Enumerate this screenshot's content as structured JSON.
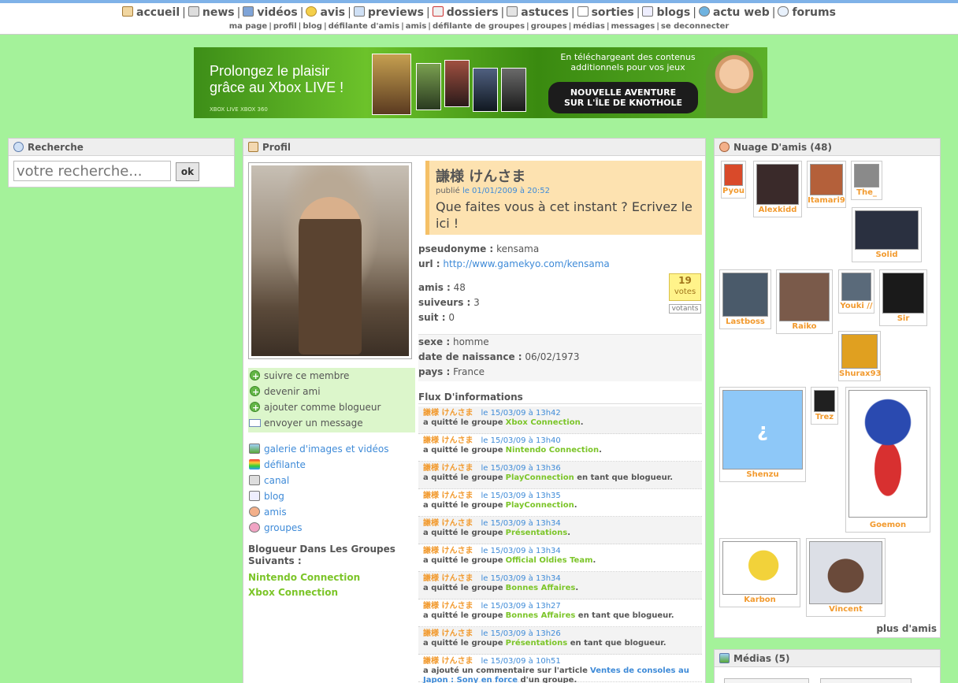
{
  "nav": {
    "main": [
      {
        "label": "accueil",
        "icon": "home-icon"
      },
      {
        "label": "news",
        "icon": "news-icon"
      },
      {
        "label": "vidéos",
        "icon": "video-icon"
      },
      {
        "label": "avis",
        "icon": "medal-icon"
      },
      {
        "label": "previews",
        "icon": "document-icon"
      },
      {
        "label": "dossiers",
        "icon": "folder-icon"
      },
      {
        "label": "astuces",
        "icon": "gamepad-icon"
      },
      {
        "label": "sorties",
        "icon": "calendar-icon"
      },
      {
        "label": "blogs",
        "icon": "blog-icon"
      },
      {
        "label": "actu web",
        "icon": "globe-icon"
      },
      {
        "label": "forums",
        "icon": "speech-bubble-icon"
      }
    ],
    "sub": [
      "ma page",
      "profil",
      "blog",
      "défilante d'amis",
      "amis",
      "défilante de groupes",
      "groupes",
      "médias",
      "messages",
      "se deconnecter"
    ]
  },
  "banner": {
    "headline_1": "Prolongez le plaisir",
    "headline_2": "grâce au Xbox LIVE !",
    "brand": "XBOX LIVE  XBOX 360",
    "side_1": "En téléchargeant des contenus",
    "side_2": "additionnels pour vos jeux",
    "cta_1": "NOUVELLE AVENTURE",
    "cta_2": "SUR L'ÎLE DE KNOTHOLE"
  },
  "search": {
    "title": "Recherche",
    "placeholder": "votre recherche...",
    "button": "ok"
  },
  "profile": {
    "title": "Profil",
    "name": "謙様 けんさま",
    "published_prefix": "publié",
    "published_date": "le 01/01/2009 à 20:52",
    "status": "Que faites vous à cet instant ? Ecrivez le ici !",
    "pseudonyme_label": "pseudonyme :",
    "pseudonyme": "kensama",
    "url_label": "url :",
    "url": "http://www.gamekyo.com/kensama",
    "amis_label": "amis :",
    "amis": "48",
    "suiveurs_label": "suiveurs :",
    "suiveurs": "3",
    "suit_label": "suit :",
    "suit": "0",
    "votes_count": "19",
    "votes_label": "votes",
    "votants_label": "votants",
    "sexe_label": "sexe :",
    "sexe": "homme",
    "naissance_label": "date de naissance :",
    "naissance": "06/02/1973",
    "pays_label": "pays :",
    "pays": "France",
    "actions": [
      "suivre ce membre",
      "devenir ami",
      "ajouter comme blogueur",
      "envoyer un message"
    ],
    "links": [
      "galerie d'images et vidéos",
      "défilante",
      "canal",
      "blog",
      "amis",
      "groupes"
    ],
    "groups_title": "Blogueur Dans Les Groupes Suivants :",
    "groups": [
      "Nintendo Connection",
      "Xbox Connection"
    ],
    "flux_title": "Flux D'informations"
  },
  "flux": [
    {
      "who": "謙様 けんさま",
      "when": "le 15/03/09 à 13h42",
      "text": "a quitté le groupe",
      "group": "Xbox Connection",
      "suffix": "."
    },
    {
      "who": "謙様 けんさま",
      "when": "le 15/03/09 à 13h40",
      "text": "a quitté le groupe",
      "group": "Nintendo Connection",
      "suffix": "."
    },
    {
      "who": "謙様 けんさま",
      "when": "le 15/03/09 à 13h36",
      "text": "a quitté le groupe",
      "group": "PlayConnection",
      "suffix": " en tant que blogueur."
    },
    {
      "who": "謙様 けんさま",
      "when": "le 15/03/09 à 13h35",
      "text": "a quitté le groupe",
      "group": "PlayConnection",
      "suffix": "."
    },
    {
      "who": "謙様 けんさま",
      "when": "le 15/03/09 à 13h34",
      "text": "a quitté le groupe",
      "group": "Présentations",
      "suffix": "."
    },
    {
      "who": "謙様 けんさま",
      "when": "le 15/03/09 à 13h34",
      "text": "a quitté le groupe",
      "group": "Official Oldies Team",
      "suffix": "."
    },
    {
      "who": "謙様 けんさま",
      "when": "le 15/03/09 à 13h34",
      "text": "a quitté le groupe",
      "group": "Bonnes Affaires",
      "suffix": "."
    },
    {
      "who": "謙様 けんさま",
      "when": "le 15/03/09 à 13h27",
      "text": "a quitté le groupe",
      "group": "Bonnes Affaires",
      "suffix": " en tant que blogueur."
    },
    {
      "who": "謙様 けんさま",
      "when": "le 15/03/09 à 13h26",
      "text": "a quitté le groupe",
      "group": "Présentations",
      "suffix": " en tant que blogueur."
    },
    {
      "who": "謙様 けんさま",
      "when": "le 15/03/09 à 10h51",
      "text": "a ajouté un commentaire sur l'article",
      "article": "Ventes de consoles au Japon : Sony en force",
      "suffix": " d'un groupe."
    }
  ],
  "friends": {
    "title": "Nuage D'amis (48)",
    "items": [
      {
        "name": "Pyou",
        "color": "#d94a2a"
      },
      {
        "name": "Alexkidd",
        "color": "#3a2a2a"
      },
      {
        "name": "Itamari9",
        "color": "#b4603a"
      },
      {
        "name": "The_",
        "color": "#8a8a8a"
      },
      {
        "name": "Solid",
        "color": "#2a3040"
      },
      {
        "name": "Lastboss",
        "color": "#4a5a6a"
      },
      {
        "name": "Raiko",
        "color": "#7a5a4a"
      },
      {
        "name": "Youki //",
        "color": "#5a6a7a"
      },
      {
        "name": "Sir",
        "color": "#1a1a1a"
      },
      {
        "name": "Shurax93",
        "color": "#e0a020"
      },
      {
        "name": "Shenzu",
        "color": "#8ec8f8"
      },
      {
        "name": "Trez",
        "color": "#202020"
      },
      {
        "name": "Goemon",
        "color": "#2a4ab0"
      },
      {
        "name": "Karbon",
        "color": "#f2d23a"
      },
      {
        "name": "Vincent",
        "color": "#6a4a3a"
      }
    ],
    "shenzu_glyph": "¿",
    "more": "plus d'amis"
  },
  "medias": {
    "title": "Médias (5)"
  }
}
